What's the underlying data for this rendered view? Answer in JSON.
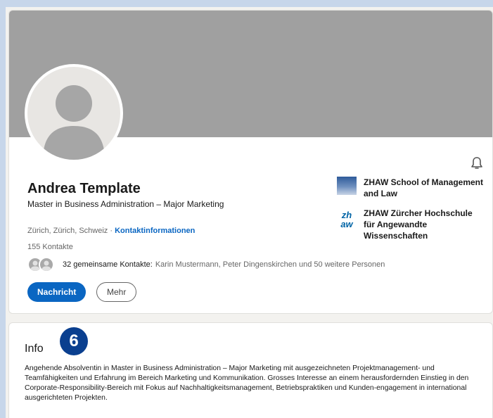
{
  "profile": {
    "name": "Andrea Template",
    "headline": "Master in Business Administration – Major Marketing",
    "location": "Zürich, Zürich, Schweiz · ",
    "contact_link": "Kontaktinformationen",
    "connections": "155 Kontakte",
    "mutual_count": "32 gemeinsame Kontakte:",
    "mutual_names": "Karin Mustermann, Peter Dingenskirchen und 50 weitere Personen",
    "message_button": "Nachricht",
    "more_button": "Mehr",
    "icons": [
      "avatar-placeholder",
      "bell-icon"
    ]
  },
  "education": [
    {
      "name": "ZHAW School of Management and Law",
      "logo": "zhaw-building-logo"
    },
    {
      "name": "ZHAW Zürcher Hochschule für Angewandte Wissenschaften",
      "logo_text": "zh\naw"
    }
  ],
  "info": {
    "title": "Info",
    "badge": "6",
    "text": "Angehende Absolventin in Master in Business Administration – Major Marketing mit ausgezeichneten Projektmanagement- und Teamfähigkeiten und Erfahrung im Bereich Marketing und Kommunikation. Grosses Interesse an einem herausfordernden Einstieg in den Corporate-Responsibility-Bereich mit Fokus auf Nachhaltigkeitsmanagement, Betriebspraktiken und Kunden-engagement in international ausgerichteten Projekten."
  },
  "colors": {
    "accent": "#0a66c2",
    "cover": "#a0a0a0",
    "badge": "#0a3f8f",
    "background": "#c7d6ea"
  }
}
